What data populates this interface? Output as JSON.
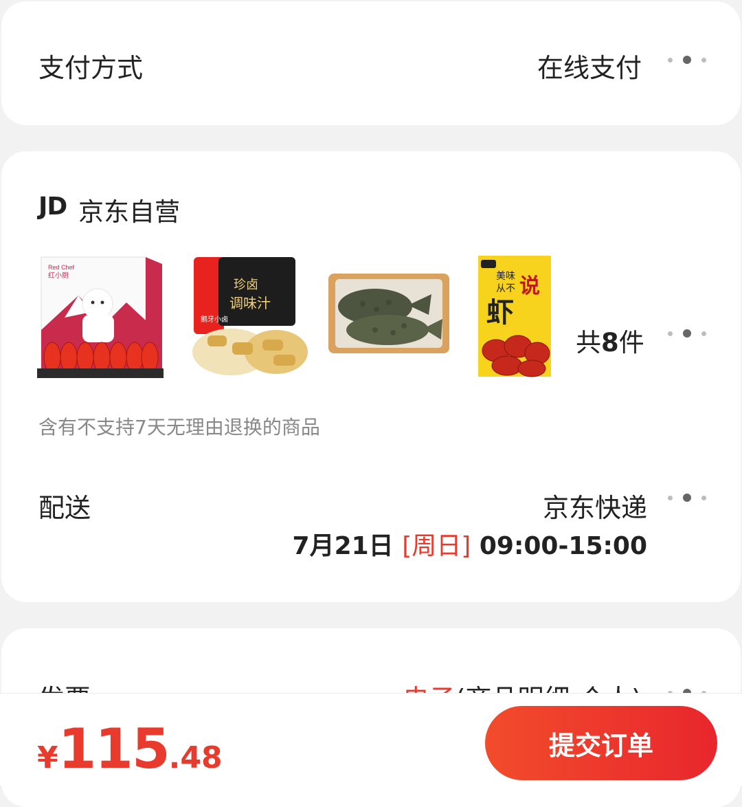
{
  "payment": {
    "title": "支付方式",
    "value": "在线支付"
  },
  "store": {
    "logo": "JD",
    "name": "京东自营",
    "products": [
      {
        "name": "红小厨小龙虾礼盒",
        "brand": "Red Chef",
        "brand_cn": "红小厨"
      },
      {
        "name": "珍卤调味汁",
        "text_a": "珍卤",
        "text_b": "调味汁",
        "side_text": "鹅牙小卤"
      },
      {
        "name": "烤鱼"
      },
      {
        "name": "小龙虾",
        "text_a": "美味",
        "text_b": "从不",
        "text_c": "虾",
        "text_d": "说"
      }
    ],
    "count_prefix": "共",
    "count": "8",
    "count_suffix": "件",
    "return_note": "含有不支持7天无理由退换的商品"
  },
  "shipping": {
    "title": "配送",
    "value": "京东快递",
    "date": "7月21日",
    "day": "[周日]",
    "time": "09:00-15:00"
  },
  "invoice": {
    "title": "发票",
    "value_accent": "电子",
    "value_rest": "(商品明细-个人)"
  },
  "footer": {
    "currency": "¥",
    "price_int": "115",
    "price_dec": ".48",
    "submit_label": "提交订单"
  },
  "colors": {
    "accent": "#e93b2d",
    "bg": "#f2f2f2"
  }
}
